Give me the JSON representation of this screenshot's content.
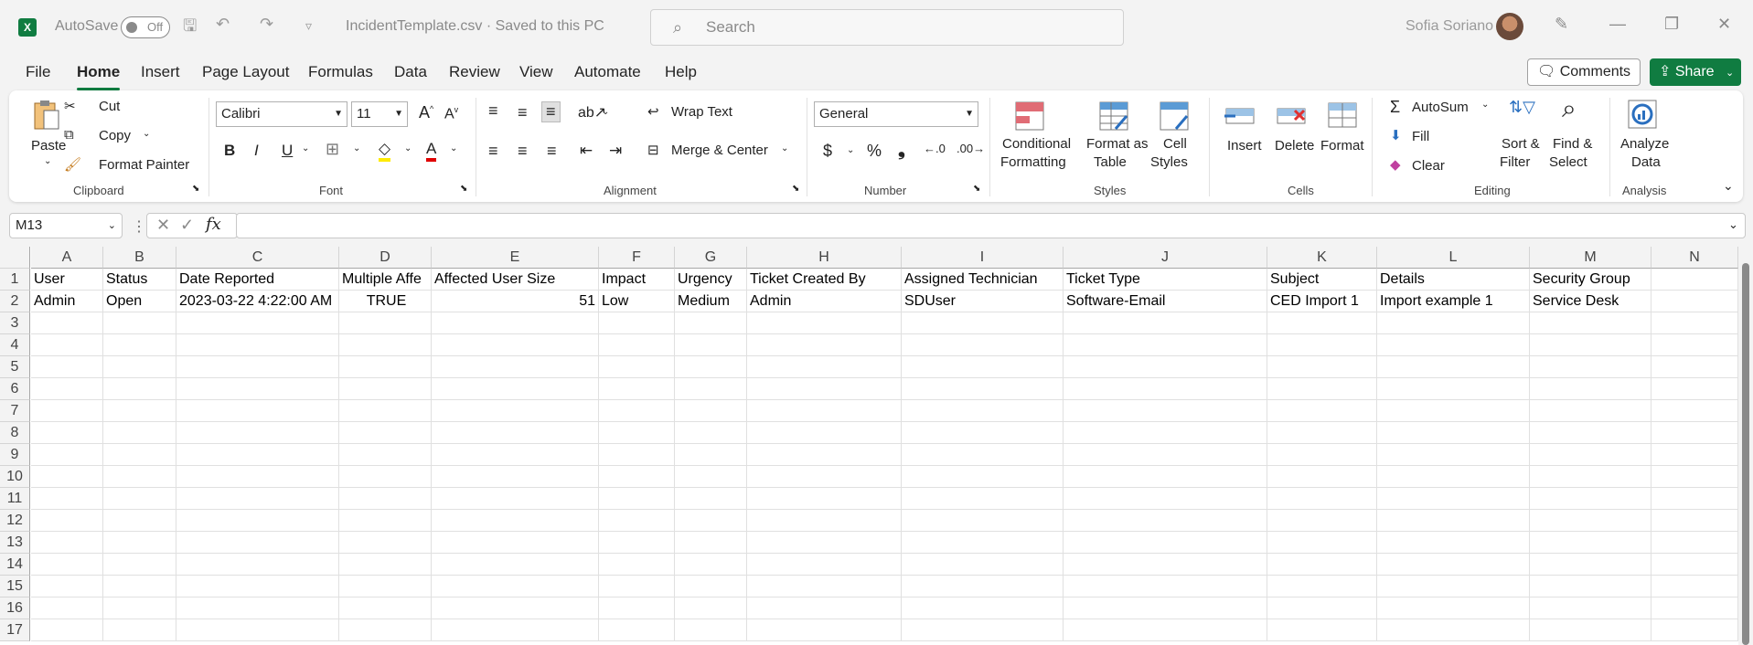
{
  "titlebar": {
    "autosave_label": "AutoSave",
    "autosave_state": "Off",
    "filename": "IncidentTemplate.csv · Saved to this PC",
    "search_placeholder": "Search",
    "user_name": "Sofia Soriano"
  },
  "menu": [
    "File",
    "Home",
    "Insert",
    "Page Layout",
    "Formulas",
    "Data",
    "Review",
    "View",
    "Automate",
    "Help"
  ],
  "menu_active": "Home",
  "comments_label": "Comments",
  "share_label": "Share",
  "ribbon": {
    "clipboard": {
      "paste": "Paste",
      "cut": "Cut",
      "copy": "Copy",
      "format_painter": "Format Painter",
      "label": "Clipboard"
    },
    "font": {
      "name": "Calibri",
      "size": "11",
      "label": "Font"
    },
    "alignment": {
      "wrap": "Wrap Text",
      "merge": "Merge & Center",
      "label": "Alignment"
    },
    "number": {
      "format": "General",
      "label": "Number"
    },
    "styles": {
      "conditional": "Conditional",
      "conditional2": "Formatting",
      "format_table": "Format as",
      "format_table2": "Table",
      "cell_styles": "Cell",
      "cell_styles2": "Styles",
      "label": "Styles"
    },
    "cells": {
      "insert": "Insert",
      "delete": "Delete",
      "format": "Format",
      "label": "Cells"
    },
    "editing": {
      "autosum": "AutoSum",
      "fill": "Fill",
      "clear": "Clear",
      "sort": "Sort &",
      "sort2": "Filter",
      "find": "Find &",
      "find2": "Select",
      "label": "Editing"
    },
    "analysis": {
      "analyze": "Analyze",
      "analyze2": "Data",
      "label": "Analysis"
    }
  },
  "formula_bar": {
    "name_box": "M13",
    "formula": ""
  },
  "columns": [
    "A",
    "B",
    "C",
    "D",
    "E",
    "F",
    "G",
    "H",
    "I",
    "J",
    "K",
    "L",
    "M",
    "N"
  ],
  "rows": [
    "1",
    "2",
    "3",
    "4",
    "5",
    "6",
    "7",
    "8",
    "9",
    "10",
    "11",
    "12",
    "13",
    "14",
    "15",
    "16",
    "17"
  ],
  "cells": {
    "header": [
      "User",
      "Status",
      "Date Reported",
      "Multiple Affe",
      "Affected User Size",
      "Impact",
      "Urgency",
      "Ticket Created By",
      "Assigned Technician",
      "Ticket Type",
      "Subject",
      "Details",
      "Security Group",
      ""
    ],
    "row2": [
      "Admin",
      "Open",
      "2023-03-22 4:22:00 AM",
      "TRUE",
      "51",
      "Low",
      "Medium",
      "Admin",
      "SDUser",
      "Software-Email",
      "CED Import 1",
      "Import example 1",
      "Service Desk",
      ""
    ]
  }
}
